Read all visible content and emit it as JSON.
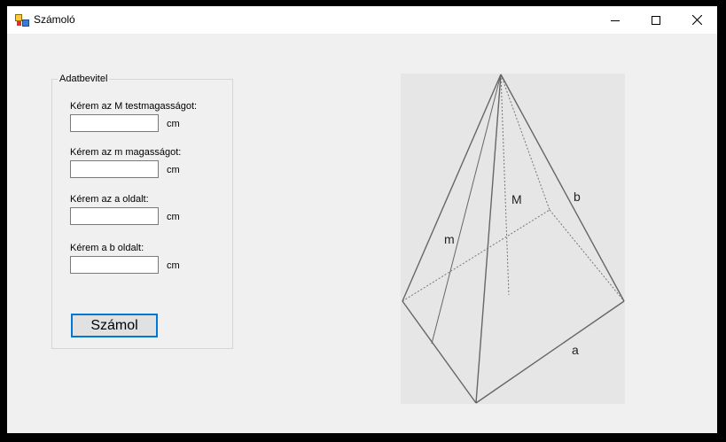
{
  "window": {
    "title": "Számoló"
  },
  "group": {
    "label": "Adatbevitel"
  },
  "fields": [
    {
      "label": "Kérem az M testmagasságot:",
      "value": "",
      "unit": "cm"
    },
    {
      "label": "Kérem az m magasságot:",
      "value": "",
      "unit": "cm"
    },
    {
      "label": "Kérem az a oldalt:",
      "value": "",
      "unit": "cm"
    },
    {
      "label": "Kérem a b oldalt:",
      "value": "",
      "unit": "cm"
    }
  ],
  "button": {
    "label": "Számol"
  },
  "figure": {
    "labels": {
      "M": "M",
      "m": "m",
      "b": "b",
      "a": "a"
    }
  },
  "icons": {
    "app": "app-icon",
    "minimize": "minimize-icon",
    "maximize": "maximize-icon",
    "close": "close-icon"
  },
  "colors": {
    "accent": "#0078d7",
    "window_bg": "#f0f0f0",
    "figure_bg": "#e6e6e6"
  }
}
